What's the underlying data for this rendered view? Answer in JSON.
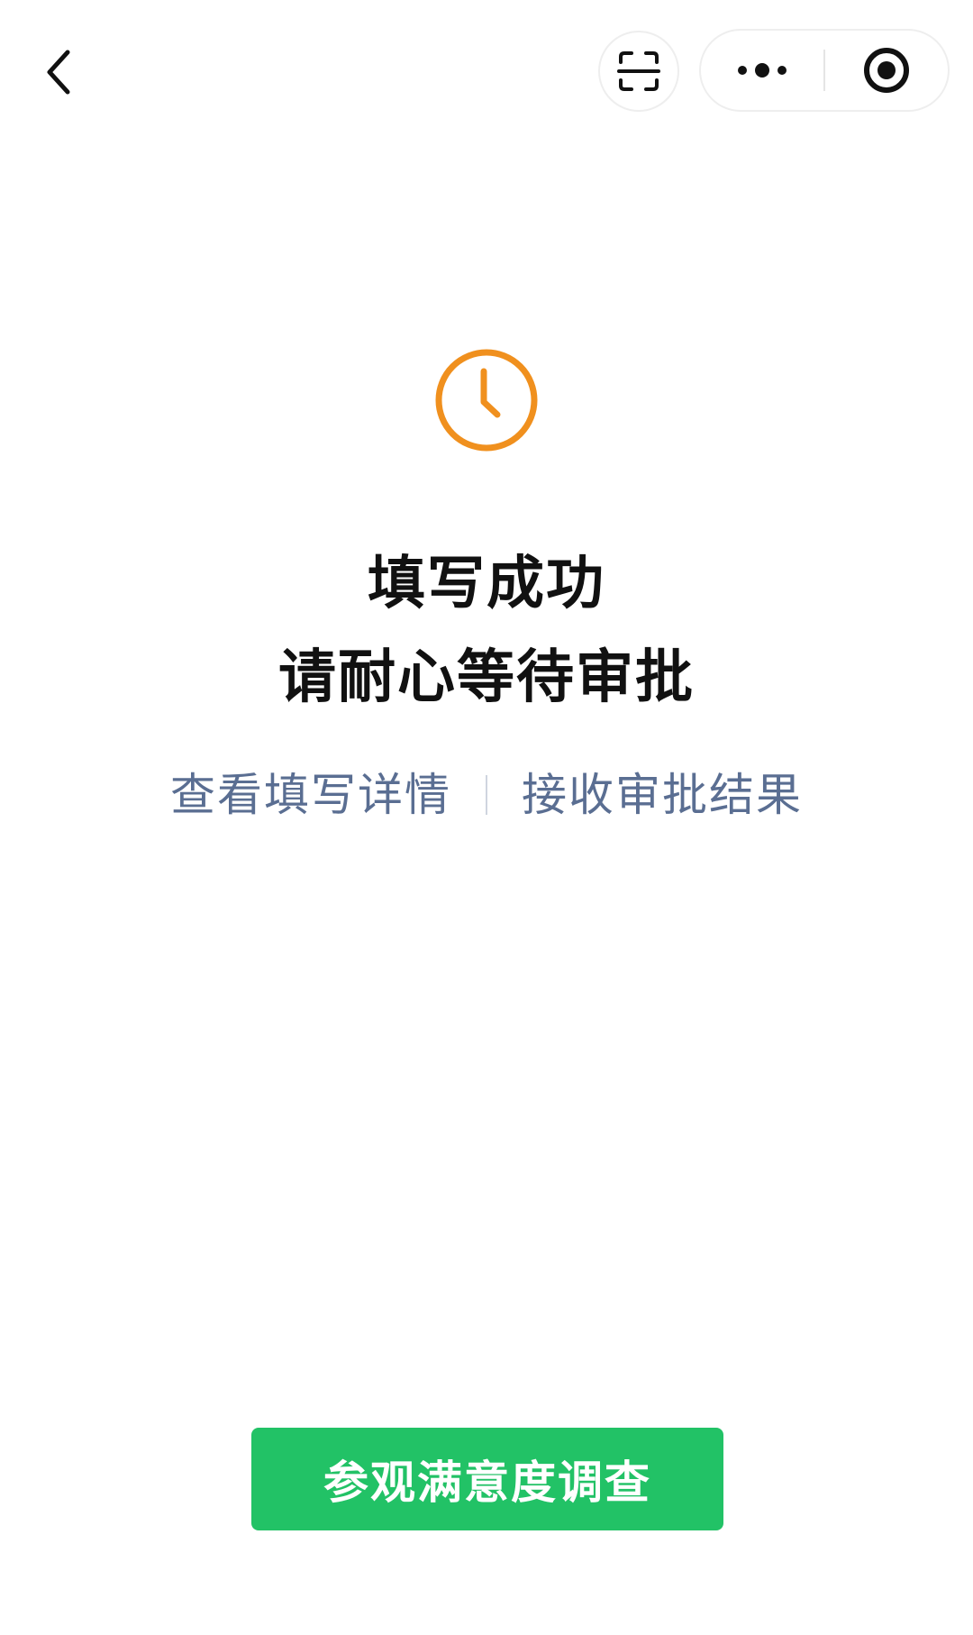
{
  "nav": {
    "back_icon": "chevron-left-icon",
    "scan_icon": "scan-frame-icon",
    "more_icon": "more-dots-icon",
    "close_icon": "target-circle-icon"
  },
  "status": {
    "icon": "clock-icon",
    "icon_color": "#f0901e",
    "title_line1": "填写成功",
    "title_line2": "请耐心等待审批"
  },
  "links": {
    "view_details": "查看填写详情",
    "receive_result": "接收审批结果",
    "color": "#5a6e92"
  },
  "survey": {
    "button_label": "参观满意度调查",
    "color": "#22c266"
  }
}
